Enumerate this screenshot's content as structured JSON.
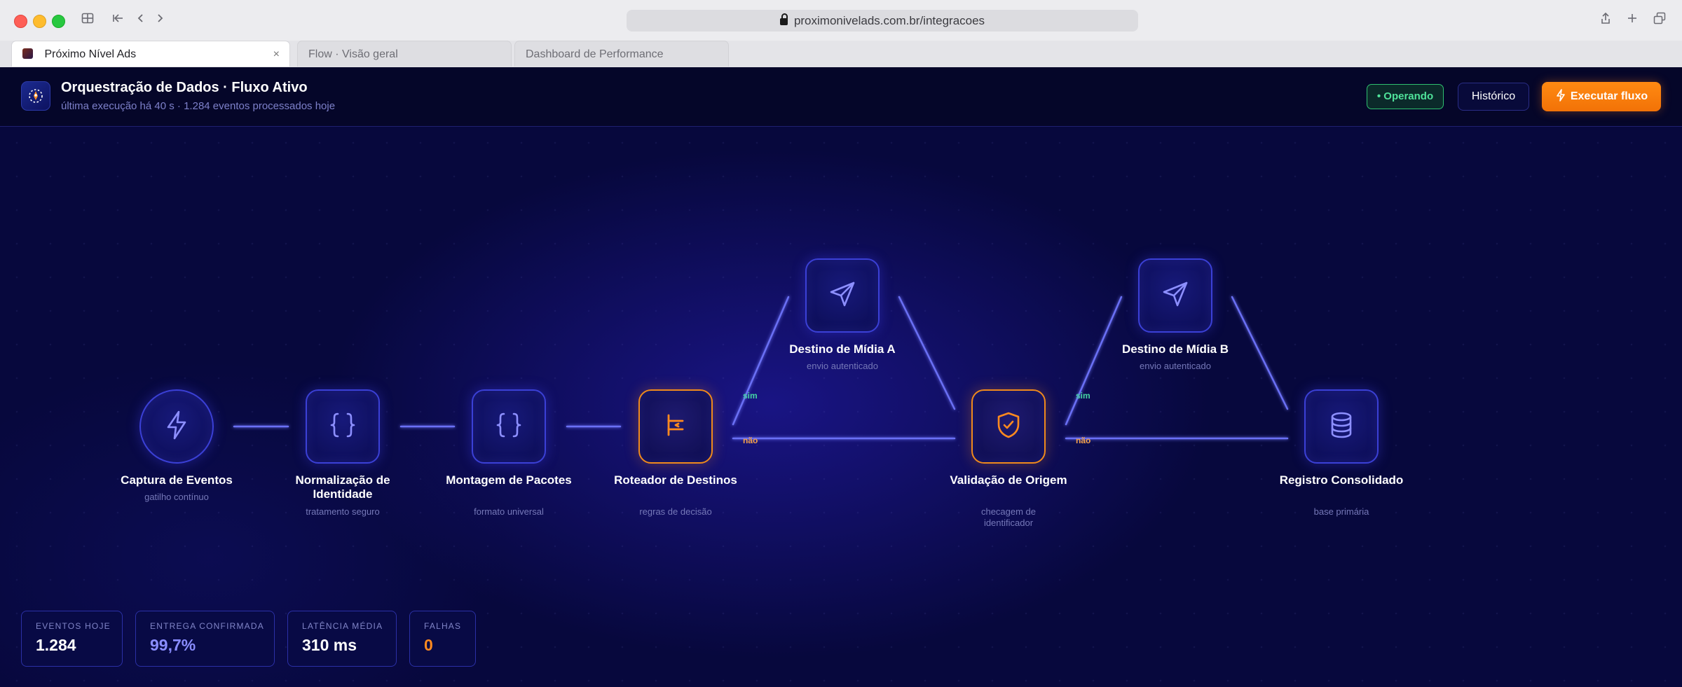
{
  "browser": {
    "url": "proximonivelads.com.br/integracoes",
    "tabs": [
      {
        "label": "Próximo Nível Ads",
        "active": true
      },
      {
        "label": "Flow · Visão geral",
        "active": false
      },
      {
        "label": "Dashboard de Performance",
        "active": false
      }
    ],
    "tab_close_glyph": "×",
    "icons": [
      "sidebar-icon",
      "back-to-start-icon",
      "back-icon",
      "forward-icon",
      "share-icon",
      "new-tab-icon",
      "tab-overview-icon"
    ]
  },
  "header": {
    "title": "Orquestração de Dados · Fluxo Ativo",
    "subtitle": "última execução há 40 s · 1.284 eventos processados hoje",
    "status_badge": "• Operando",
    "history_button": "Histórico",
    "run_button": "Executar fluxo"
  },
  "flow": {
    "nodes": [
      {
        "id": "captura",
        "label": "Captura de Eventos",
        "sub": "gatilho contínuo",
        "icon": "bolt-icon"
      },
      {
        "id": "normalizacao",
        "label": "Normalização de Identidade",
        "sub": "tratamento seguro",
        "icon": "braces-icon"
      },
      {
        "id": "montagem",
        "label": "Montagem de Pacotes",
        "sub": "formato universal",
        "icon": "braces-icon"
      },
      {
        "id": "roteador",
        "label": "Roteador de Destinos",
        "sub": "regras de decisão",
        "icon": "router-icon"
      },
      {
        "id": "midia-a",
        "label": "Destino de Mídia A",
        "sub": "envio autenticado",
        "icon": "send-icon"
      },
      {
        "id": "validacao",
        "label": "Validação de Origem",
        "sub": "checagem de identificador",
        "icon": "shield-check-icon"
      },
      {
        "id": "midia-b",
        "label": "Destino de Mídia B",
        "sub": "envio autenticado",
        "icon": "send-icon"
      },
      {
        "id": "registro",
        "label": "Registro Consolidado",
        "sub": "base primária",
        "icon": "database-icon"
      }
    ],
    "edge_labels": {
      "yes": "sim",
      "no": "não"
    },
    "colors": {
      "node_border": "#3b40d6",
      "accent": "#f08a1c",
      "edge": "#6b6ff5",
      "yes": "#45d6a4",
      "no": "#f3a04b"
    }
  },
  "stats": [
    {
      "label": "EVENTOS HOJE",
      "value": "1.284"
    },
    {
      "label": "ENTREGA CONFIRMADA",
      "value": "99,7%"
    },
    {
      "label": "LATÊNCIA MÉDIA",
      "value": "310 ms"
    },
    {
      "label": "FALHAS",
      "value": "0"
    }
  ]
}
